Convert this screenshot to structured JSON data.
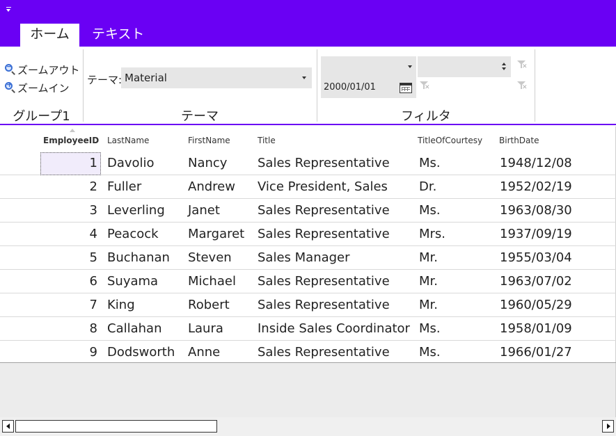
{
  "tabs": [
    {
      "label": "ホーム",
      "active": true
    },
    {
      "label": "テキスト",
      "active": false
    }
  ],
  "ribbon": {
    "group1": {
      "zoom_out_label": "ズームアウト",
      "zoom_in_label": "ズームイン",
      "label": "グループ1"
    },
    "theme": {
      "prefix": "テーマ:",
      "selected": "Material",
      "label": "テーマ"
    },
    "filter": {
      "date_value": "2000/01/01",
      "label": "フィルタ"
    }
  },
  "grid": {
    "columns": [
      "EmployeeID",
      "LastName",
      "FirstName",
      "Title",
      "TitleOfCourtesy",
      "BirthDate"
    ],
    "rows": [
      {
        "id": "1",
        "last": "Davolio",
        "first": "Nancy",
        "title": "Sales Representative",
        "courtesy": "Ms.",
        "birth": "1948/12/08"
      },
      {
        "id": "2",
        "last": "Fuller",
        "first": "Andrew",
        "title": "Vice President, Sales",
        "courtesy": "Dr.",
        "birth": "1952/02/19"
      },
      {
        "id": "3",
        "last": "Leverling",
        "first": "Janet",
        "title": "Sales Representative",
        "courtesy": "Ms.",
        "birth": "1963/08/30"
      },
      {
        "id": "4",
        "last": "Peacock",
        "first": "Margaret",
        "title": "Sales Representative",
        "courtesy": "Mrs.",
        "birth": "1937/09/19"
      },
      {
        "id": "5",
        "last": "Buchanan",
        "first": "Steven",
        "title": "Sales Manager",
        "courtesy": "Mr.",
        "birth": "1955/03/04"
      },
      {
        "id": "6",
        "last": "Suyama",
        "first": "Michael",
        "title": "Sales Representative",
        "courtesy": "Mr.",
        "birth": "1963/07/02"
      },
      {
        "id": "7",
        "last": "King",
        "first": "Robert",
        "title": "Sales Representative",
        "courtesy": "Mr.",
        "birth": "1960/05/29"
      },
      {
        "id": "8",
        "last": "Callahan",
        "first": "Laura",
        "title": "Inside Sales Coordinator",
        "courtesy": "Ms.",
        "birth": "1958/01/09"
      },
      {
        "id": "9",
        "last": "Dodsworth",
        "first": "Anne",
        "title": "Sales Representative",
        "courtesy": "Ms.",
        "birth": "1966/01/27"
      }
    ]
  },
  "colors": {
    "accent": "#6a00f4",
    "focus_cell": "#f1ecfb"
  },
  "icons": {
    "qat": "dropdown-arrow-icon",
    "zoom_out": "zoom-out-icon",
    "zoom_in": "zoom-in-icon",
    "calendar": "calendar-icon",
    "clear_filter": "clear-filter-icon"
  }
}
